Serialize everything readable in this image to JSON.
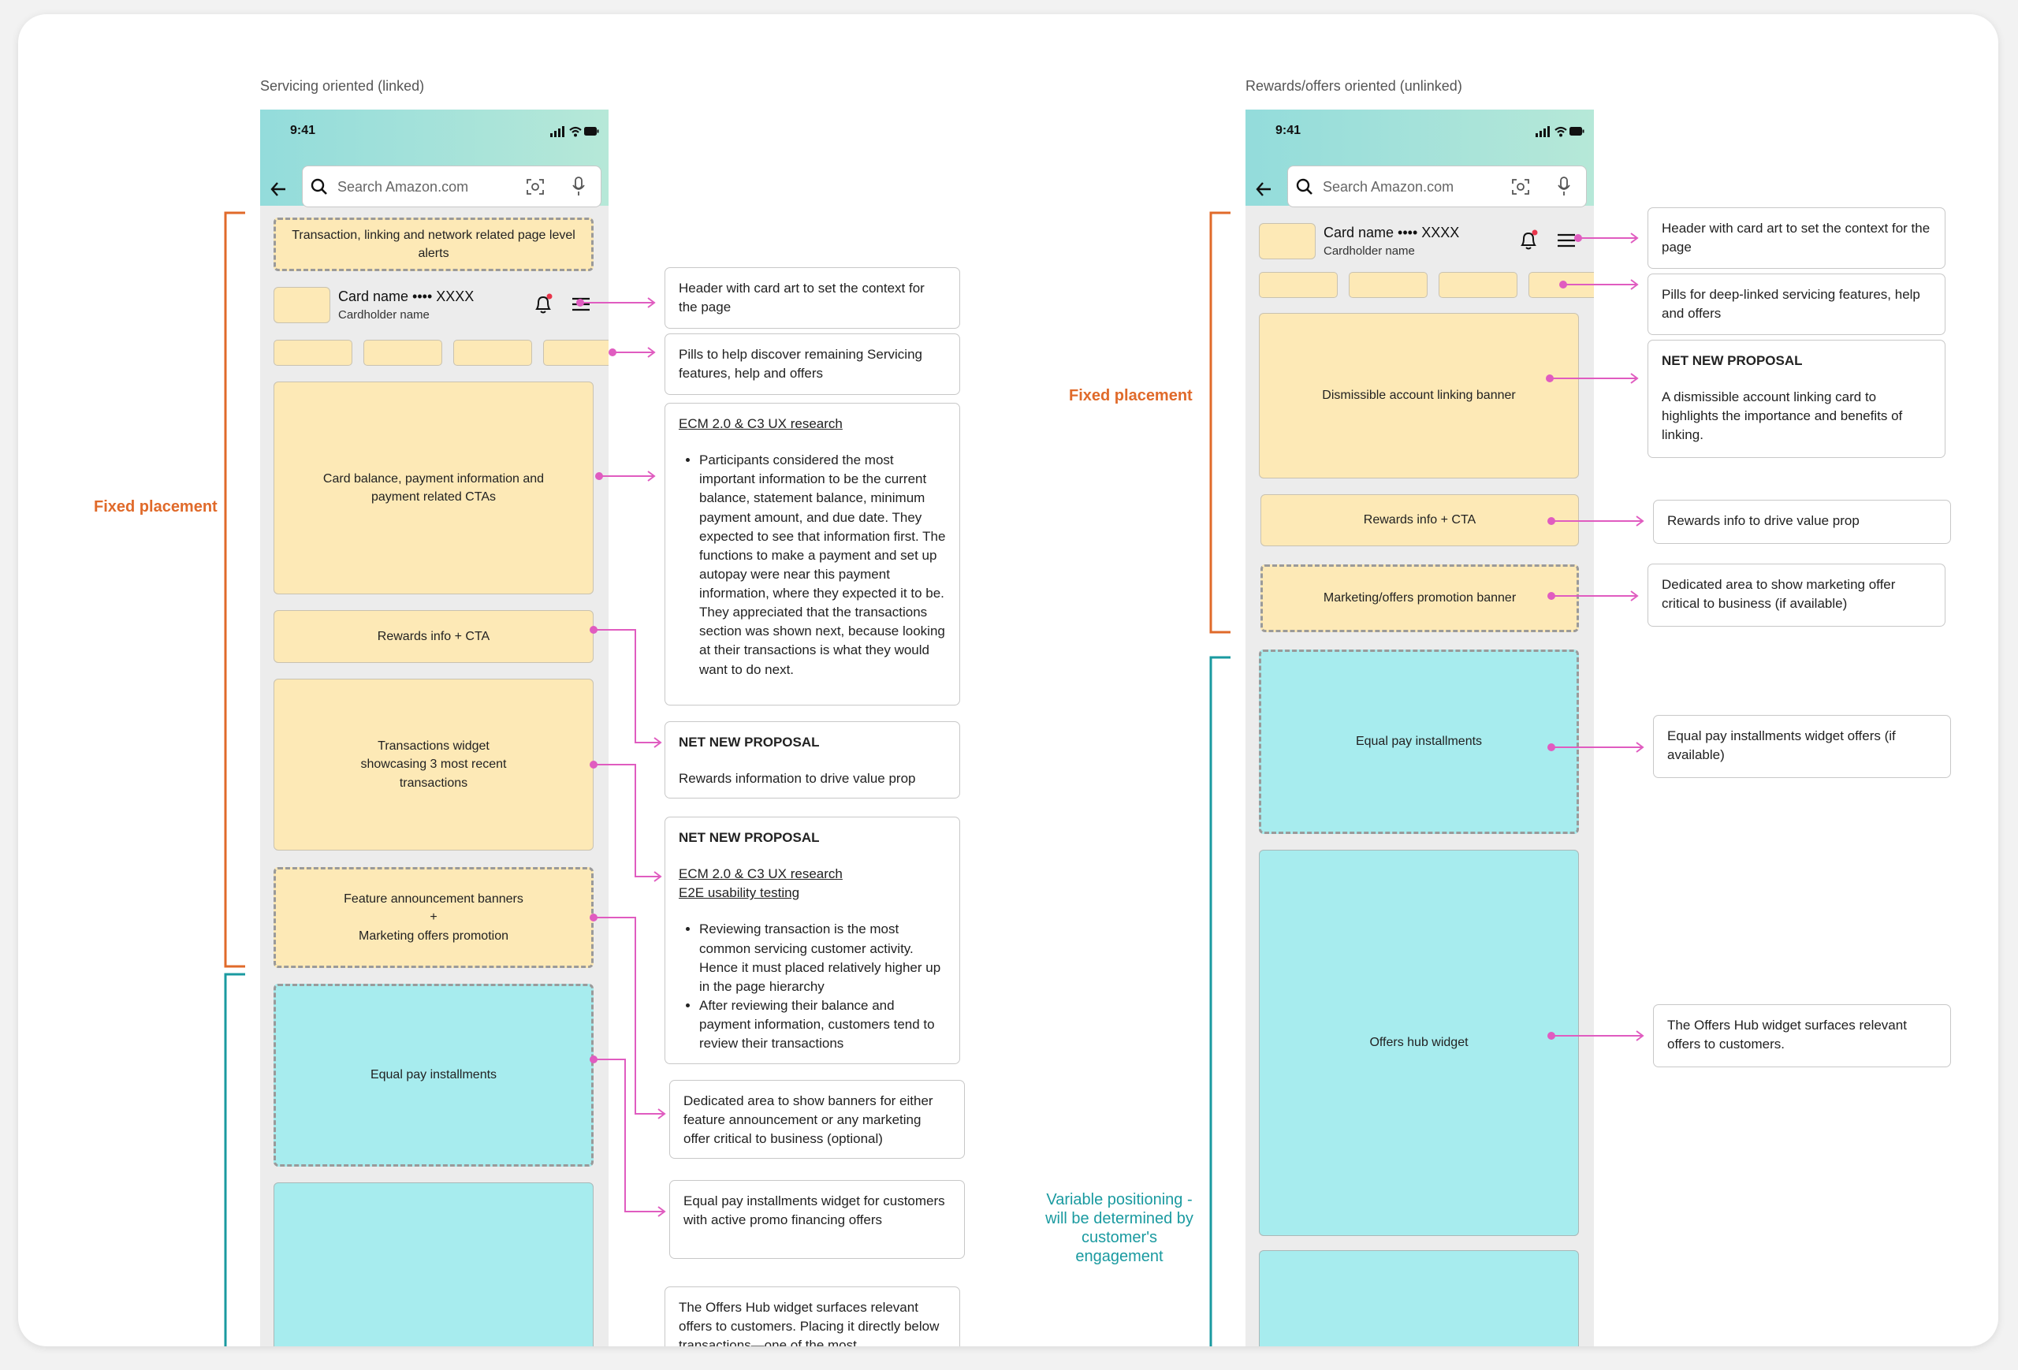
{
  "left": {
    "section_title": "Servicing oriented (linked)",
    "status_time": "9:41",
    "search_placeholder": "Search Amazon.com",
    "card_name": "Card name •••• XXXX",
    "cardholder": "Cardholder name",
    "bracket_fixed_label": "Fixed placement",
    "boxes": {
      "alerts": "Transaction, linking and network related page level alerts",
      "balance": "Card balance, payment information and payment related CTAs",
      "rewards": "Rewards info + CTA",
      "transactions": "Transactions widget showcasing 3 most recent transactions",
      "banners_line1": "Feature announcement banners",
      "banners_plus": "+",
      "banners_line2": "Marketing offers promotion",
      "equal_pay": "Equal pay installments"
    },
    "annotations": {
      "header": "Header with card art to set the context for the page",
      "pills": "Pills to help discover remaining Servicing features, help and offers",
      "research_link": "ECM 2.0 & C3 UX research",
      "research_bullet": "Participants considered the most important information to be the current balance, statement balance, minimum payment amount, and due date. They expected to see that information first. The functions to make a payment and set up autopay were near this payment information, where they expected it to be. They appreciated that the transactions section was shown next, because looking at their transactions is what they would want to do next.",
      "rewards_heading": "NET NEW PROPOSAL",
      "rewards_text": "Rewards information to drive value prop",
      "tx_heading": "NET NEW PROPOSAL",
      "tx_link1": "ECM 2.0 & C3 UX research",
      "tx_link2": "E2E usability testing",
      "tx_bullet1": "Reviewing transaction is the most common servicing customer activity. Hence it must placed relatively higher up in the page hierarchy",
      "tx_bullet2": "After reviewing their balance and payment information, customers tend to review their transactions",
      "banners": "Dedicated area to show banners for either feature announcement or any marketing offer critical to business (optional)",
      "equal_pay": "Equal pay installments widget for customers with active promo financing offers",
      "offers_hub": "The Offers Hub widget surfaces relevant offers to customers. Placing it directly below transactions—one of the most"
    }
  },
  "right": {
    "section_title": "Rewards/offers oriented (unlinked)",
    "status_time": "9:41",
    "search_placeholder": "Search Amazon.com",
    "card_name": "Card name •••• XXXX",
    "cardholder": "Cardholder name",
    "bracket_fixed_label": "Fixed placement",
    "bracket_variable_label": "Variable positioning - will be determined by customer's engagement",
    "boxes": {
      "linking_banner": "Dismissible account linking banner",
      "rewards": "Rewards info + CTA",
      "marketing": "Marketing/offers promotion banner",
      "equal_pay": "Equal pay installments",
      "offers_hub": "Offers hub widget"
    },
    "annotations": {
      "header": "Header with card art to set the context for the page",
      "pills": "Pills for deep-linked servicing features, help and offers",
      "linking_heading": "NET NEW PROPOSAL",
      "linking_text": "A dismissible account linking card to highlights the importance and benefits of linking.",
      "rewards": "Rewards info to drive value prop",
      "marketing": "Dedicated area to show marketing offer critical to business (if available)",
      "equal_pay": "Equal pay installments widget offers (if available)",
      "offers_hub": "The Offers Hub widget surfaces relevant offers to customers."
    }
  },
  "colors": {
    "fixed_bracket": "#e06a2a",
    "variable_bracket": "#1a9aa0",
    "connector": "#e05cc0",
    "yellow_box": "#fde9b6",
    "cyan_box": "#a7ecee"
  },
  "icons": [
    "back-arrow-icon",
    "search-icon",
    "camera-scan-icon",
    "microphone-icon",
    "bell-icon",
    "hamburger-menu-icon",
    "signal-icon",
    "wifi-icon",
    "battery-icon"
  ]
}
